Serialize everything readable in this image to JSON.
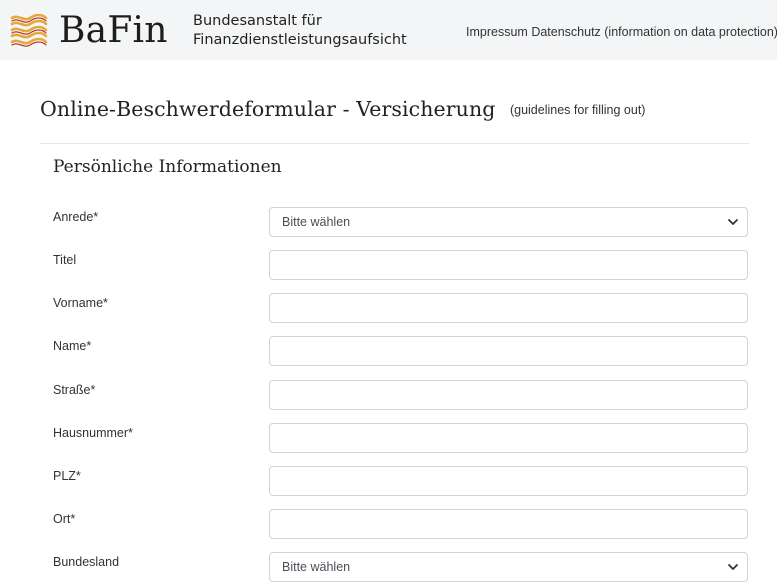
{
  "header": {
    "logo_text": "BaFin",
    "org_name_line1": "Bundesanstalt für",
    "org_name_line2": "Finanzdienstleistungsaufsicht",
    "nav_impressum": "Impressum",
    "nav_datenschutz": "Datenschutz (information on data protection)",
    "logo_color": "#e2a93b"
  },
  "page": {
    "title": "Online-Beschwerdeformular - Versicherung",
    "guidelines_link": "(guidelines for filling out)"
  },
  "section": {
    "title": "Persönliche Informationen"
  },
  "form": {
    "anrede": {
      "label": "Anrede*",
      "value": "Bitte wählen"
    },
    "titel": {
      "label": "Titel",
      "value": ""
    },
    "vorname": {
      "label": "Vorname*",
      "value": ""
    },
    "name": {
      "label": "Name*",
      "value": ""
    },
    "strasse": {
      "label": "Straße*",
      "value": ""
    },
    "hausnummer": {
      "label": "Hausnummer*",
      "value": ""
    },
    "plz": {
      "label": "PLZ*",
      "value": ""
    },
    "ort": {
      "label": "Ort*",
      "value": ""
    },
    "bundesland": {
      "label": "Bundesland",
      "value": "Bitte wählen"
    }
  },
  "icons": {
    "logo": "bafin-waves-icon",
    "select_arrow": "chevron-down-icon"
  }
}
